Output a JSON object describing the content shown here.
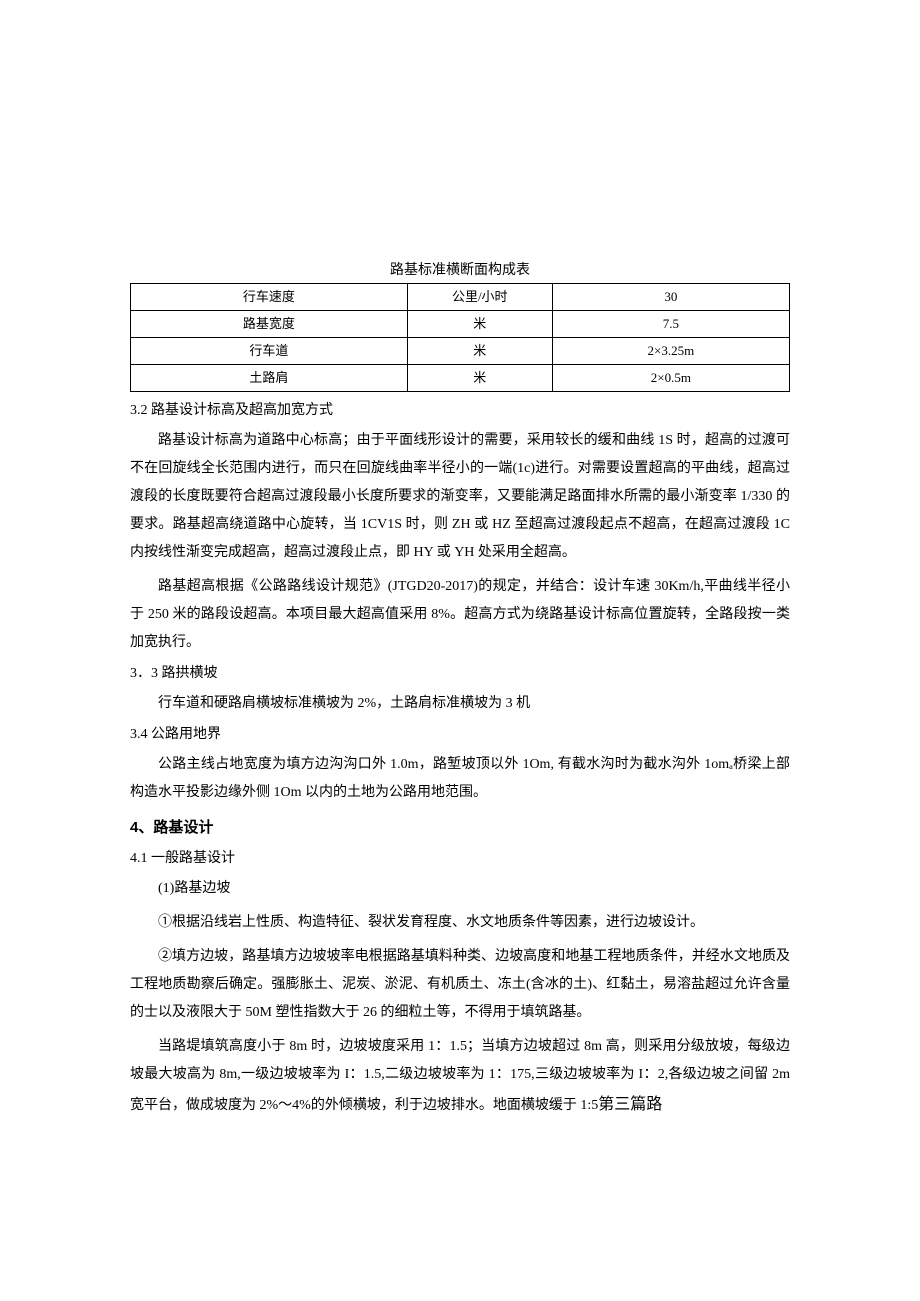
{
  "table": {
    "title": "路基标准横断面构成表",
    "rows": [
      {
        "c1": "行车速度",
        "c2": "公里/小时",
        "c3": "30"
      },
      {
        "c1": "路基宽度",
        "c2": "米",
        "c3": "7.5"
      },
      {
        "c1": "行车道",
        "c2": "米",
        "c3": "2×3.25m"
      },
      {
        "c1": "土路肩",
        "c2": "米",
        "c3": "2×0.5m"
      }
    ]
  },
  "s32": {
    "heading": "3.2 路基设计标高及超高加宽方式",
    "p1": "路基设计标高为道路中心标高；由于平面线形设计的需要，采用较长的缓和曲线 1S 时，超高的过渡可不在回旋线全长范围内进行，而只在回旋线曲率半径小的一端(1c)进行。对需要设置超高的平曲线，超高过渡段的长度既要符合超高过渡段最小长度所要求的渐变率，又要能满足路面排水所需的最小渐变率 1/330 的要求。路基超高绕道路中心旋转，当 1CV1S 时，则 ZH 或 HZ 至超高过渡段起点不超高，在超高过渡段 1C 内按线性渐变完成超高，超高过渡段止点，即 HY 或 YH 处采用全超高。",
    "p2": "路基超高根据《公路路线设计规范》(JTGD20-2017)的规定，并结合：设计车速 30Km/h,平曲线半径小于 250 米的路段设超高。本项目最大超高值采用 8%。超高方式为绕路基设计标高位置旋转，全路段按一类加宽执行。"
  },
  "s33": {
    "heading": "3．3 路拱横坡",
    "p1": "行车道和硬路肩横坡标准横坡为 2%，土路肩标准横坡为 3 机"
  },
  "s34": {
    "heading": "3.4 公路用地界",
    "p1": "公路主线占地宽度为填方边沟沟口外 1.0m，路堑坡顶以外 1Om, 有截水沟时为截水沟外 1omₐ桥梁上部构造水平投影边缘外侧 1Om 以内的土地为公路用地范围。"
  },
  "s4": {
    "heading": "4、路基设计",
    "sub41": "4.1 一般路基设计",
    "item1": "(1)路基边坡",
    "p1": "①根据沿线岩上性质、构造特征、裂状发育程度、水文地质条件等因素，进行边坡设计。",
    "p2": "②填方边坡，路基填方边坡坡率电根据路基填料种类、边坡高度和地基工程地质条件，并经水文地质及工程地质勘察后确定。强膨胀土、泥炭、淤泥、有机质土、冻土(含冰的土)、红黏土，易溶盐超过允许含量的士以及液限大于 50M 塑性指数大于 26 的细粒土等，不得用于填筑路基。",
    "p3_a": "当路堤填筑高度小于 8m 时，边坡坡度采用 1：1.5；当填方边坡超过 8m 高，则采用分级放坡，每级边坡最大坡高为 8m,一级边坡坡率为 I：1.5,二级边坡坡率为 1：175,三级边坡坡率为 I：2,各级边坡之间留 2m 宽平台，做成坡度为 2%～4%的外倾横坡，利于边坡排水。地面横坡缓于 1:5",
    "p3_trail": "第三篇路"
  }
}
